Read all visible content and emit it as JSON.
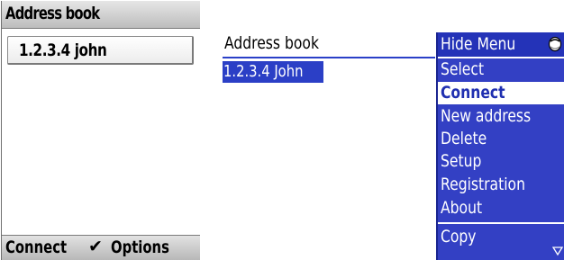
{
  "left_screen": {
    "title": "Address book",
    "list_items": [
      {
        "label": "1.2.3.4 john"
      }
    ],
    "softkeys": {
      "left": "Connect",
      "center_icon": "checkmark-icon",
      "center_glyph": "✔",
      "right": "Options"
    }
  },
  "right_screen": {
    "title": "Address book",
    "list_items": [
      {
        "label": "1.2.3.4 John"
      }
    ],
    "menu": {
      "header": "Hide Menu",
      "header_icon": "trackwheel-icon",
      "items": [
        {
          "label": "Select"
        },
        {
          "label": "Connect"
        },
        {
          "label": "New address"
        },
        {
          "label": "Delete"
        },
        {
          "label": "Setup"
        },
        {
          "label": "Registration"
        },
        {
          "label": "About"
        },
        {
          "label": "Copy"
        }
      ],
      "selected": "Connect",
      "more_indicator": "scroll-down-arrow-icon"
    }
  },
  "colors": {
    "menu_background": "#3340c4",
    "selection_highlight": "#2b3fc6",
    "softkey_bar": "#c8c8c8"
  }
}
